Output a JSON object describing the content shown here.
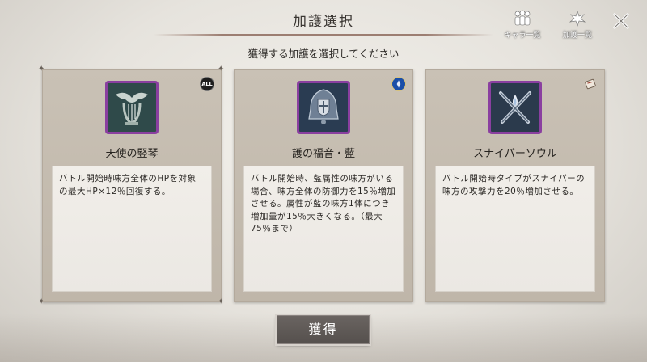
{
  "header": {
    "title": "加護選択",
    "subtitle": "獲得する加護を選択してください",
    "chara_list_label": "キャラ一覧",
    "kago_list_label": "加護一覧"
  },
  "cards": [
    {
      "name": "天使の竪琴",
      "badge": "ALL",
      "description": "バトル開始時味方全体のHPを対象の最大HP×12％回復する。",
      "icon": "angel-harp-icon"
    },
    {
      "name": "護の福音・藍",
      "badge": "",
      "description": "バトル開始時、藍属性の味方がいる場合、味方全体の防御力を15％増加させる。属性が藍の味方1体につき増加量が15％大きくなる。（最大75％まで）",
      "icon": "bell-shield-icon"
    },
    {
      "name": "スナイパーソウル",
      "badge": "",
      "description": "バトル開始時タイプがスナイパーの味方の攻撃力を20％増加させる。",
      "icon": "crossed-rifles-icon"
    }
  ],
  "footer": {
    "acquire_label": "獲得"
  },
  "colors": {
    "icon_frame": "#8a3fa0",
    "card_bg": "#c9c1b5",
    "button_bg": "#5f5956"
  }
}
